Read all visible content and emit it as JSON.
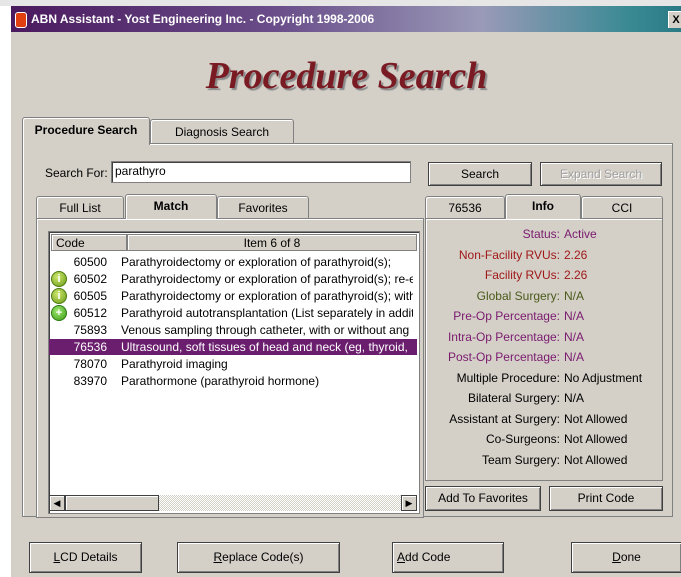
{
  "window": {
    "title": "ABN Assistant - Yost Engineering Inc. - Copyright 1998-2006",
    "close_glyph": "X"
  },
  "heading": "Procedure Search",
  "outer_tabs": [
    {
      "label": "Procedure Search"
    },
    {
      "label": "Diagnosis Search"
    }
  ],
  "search": {
    "label": "Search For:",
    "value": "parathyro",
    "search_button": "Search",
    "expand_button": "Expand Search"
  },
  "left_tabs": [
    {
      "label": "Full List"
    },
    {
      "label": "Match"
    },
    {
      "label": "Favorites"
    }
  ],
  "list": {
    "code_header": "Code",
    "count_header": "Item 6 of 8",
    "rows": [
      {
        "code": "60500",
        "icon": "",
        "desc": "Parathyroidectomy or exploration of parathyroid(s);"
      },
      {
        "code": "60502",
        "icon": "info-icon",
        "desc": "Parathyroidectomy or exploration of parathyroid(s); re-e"
      },
      {
        "code": "60505",
        "icon": "info-icon",
        "desc": "Parathyroidectomy or exploration of parathyroid(s); with"
      },
      {
        "code": "60512",
        "icon": "plus-icon",
        "desc": "Parathyroid autotransplantation (List separately in addit"
      },
      {
        "code": "75893",
        "icon": "",
        "desc": "Venous sampling through catheter, with or without ang"
      },
      {
        "code": "76536",
        "icon": "",
        "desc": "Ultrasound, soft tissues of head and neck (eg, thyroid,"
      },
      {
        "code": "78070",
        "icon": "",
        "desc": "Parathyroid imaging"
      },
      {
        "code": "83970",
        "icon": "",
        "desc": "Parathormone (parathyroid hormone)"
      }
    ],
    "selected_index": 5
  },
  "right_tabs": [
    {
      "label": "76536"
    },
    {
      "label": "Info"
    },
    {
      "label": "CCI"
    }
  ],
  "info": [
    {
      "label": "Status:",
      "value": "Active",
      "label_color": "#7a1a6e",
      "value_color": "#7a1a6e"
    },
    {
      "label": "Non-Facility RVUs:",
      "value": "2.26",
      "label_color": "#a01818",
      "value_color": "#a01818"
    },
    {
      "label": "Facility RVUs:",
      "value": "2.26",
      "label_color": "#a01818",
      "value_color": "#a01818"
    },
    {
      "label": "Global Surgery:",
      "value": "N/A",
      "label_color": "#4a5a1a",
      "value_color": "#4a5a1a"
    },
    {
      "label": "Pre-Op Percentage:",
      "value": "N/A",
      "label_color": "#7a1a6e",
      "value_color": "#7a1a6e"
    },
    {
      "label": "Intra-Op Percentage:",
      "value": "N/A",
      "label_color": "#7a1a6e",
      "value_color": "#7a1a6e"
    },
    {
      "label": "Post-Op Percentage:",
      "value": "N/A",
      "label_color": "#7a1a6e",
      "value_color": "#7a1a6e"
    },
    {
      "label": "Multiple Procedure:",
      "value": "No Adjustment",
      "label_color": "#000000",
      "value_color": "#000000"
    },
    {
      "label": "Bilateral Surgery:",
      "value": "N/A",
      "label_color": "#000000",
      "value_color": "#000000"
    },
    {
      "label": "Assistant at Surgery:",
      "value": "Not Allowed",
      "label_color": "#000000",
      "value_color": "#000000"
    },
    {
      "label": "Co-Surgeons:",
      "value": "Not Allowed",
      "label_color": "#000000",
      "value_color": "#000000"
    },
    {
      "label": "Team Surgery:",
      "value": "Not Allowed",
      "label_color": "#000000",
      "value_color": "#000000"
    }
  ],
  "actions": {
    "add_favorites": "Add To Favorites",
    "print_code": "Print Code"
  },
  "footer": {
    "lcd": {
      "mnemonic": "L",
      "rest": "CD Details"
    },
    "replace": {
      "mnemonic": "R",
      "rest": "eplace Code(s)"
    },
    "add": {
      "mnemonic": "A",
      "rest": "dd Code"
    },
    "done": {
      "mnemonic": "D",
      "rest": "one"
    }
  },
  "colors": {
    "title_gradient_start": "#4a1a5e",
    "heading": "#7a1a22",
    "selection": "#6b1e6e",
    "window_face": "#d4d0c8"
  }
}
